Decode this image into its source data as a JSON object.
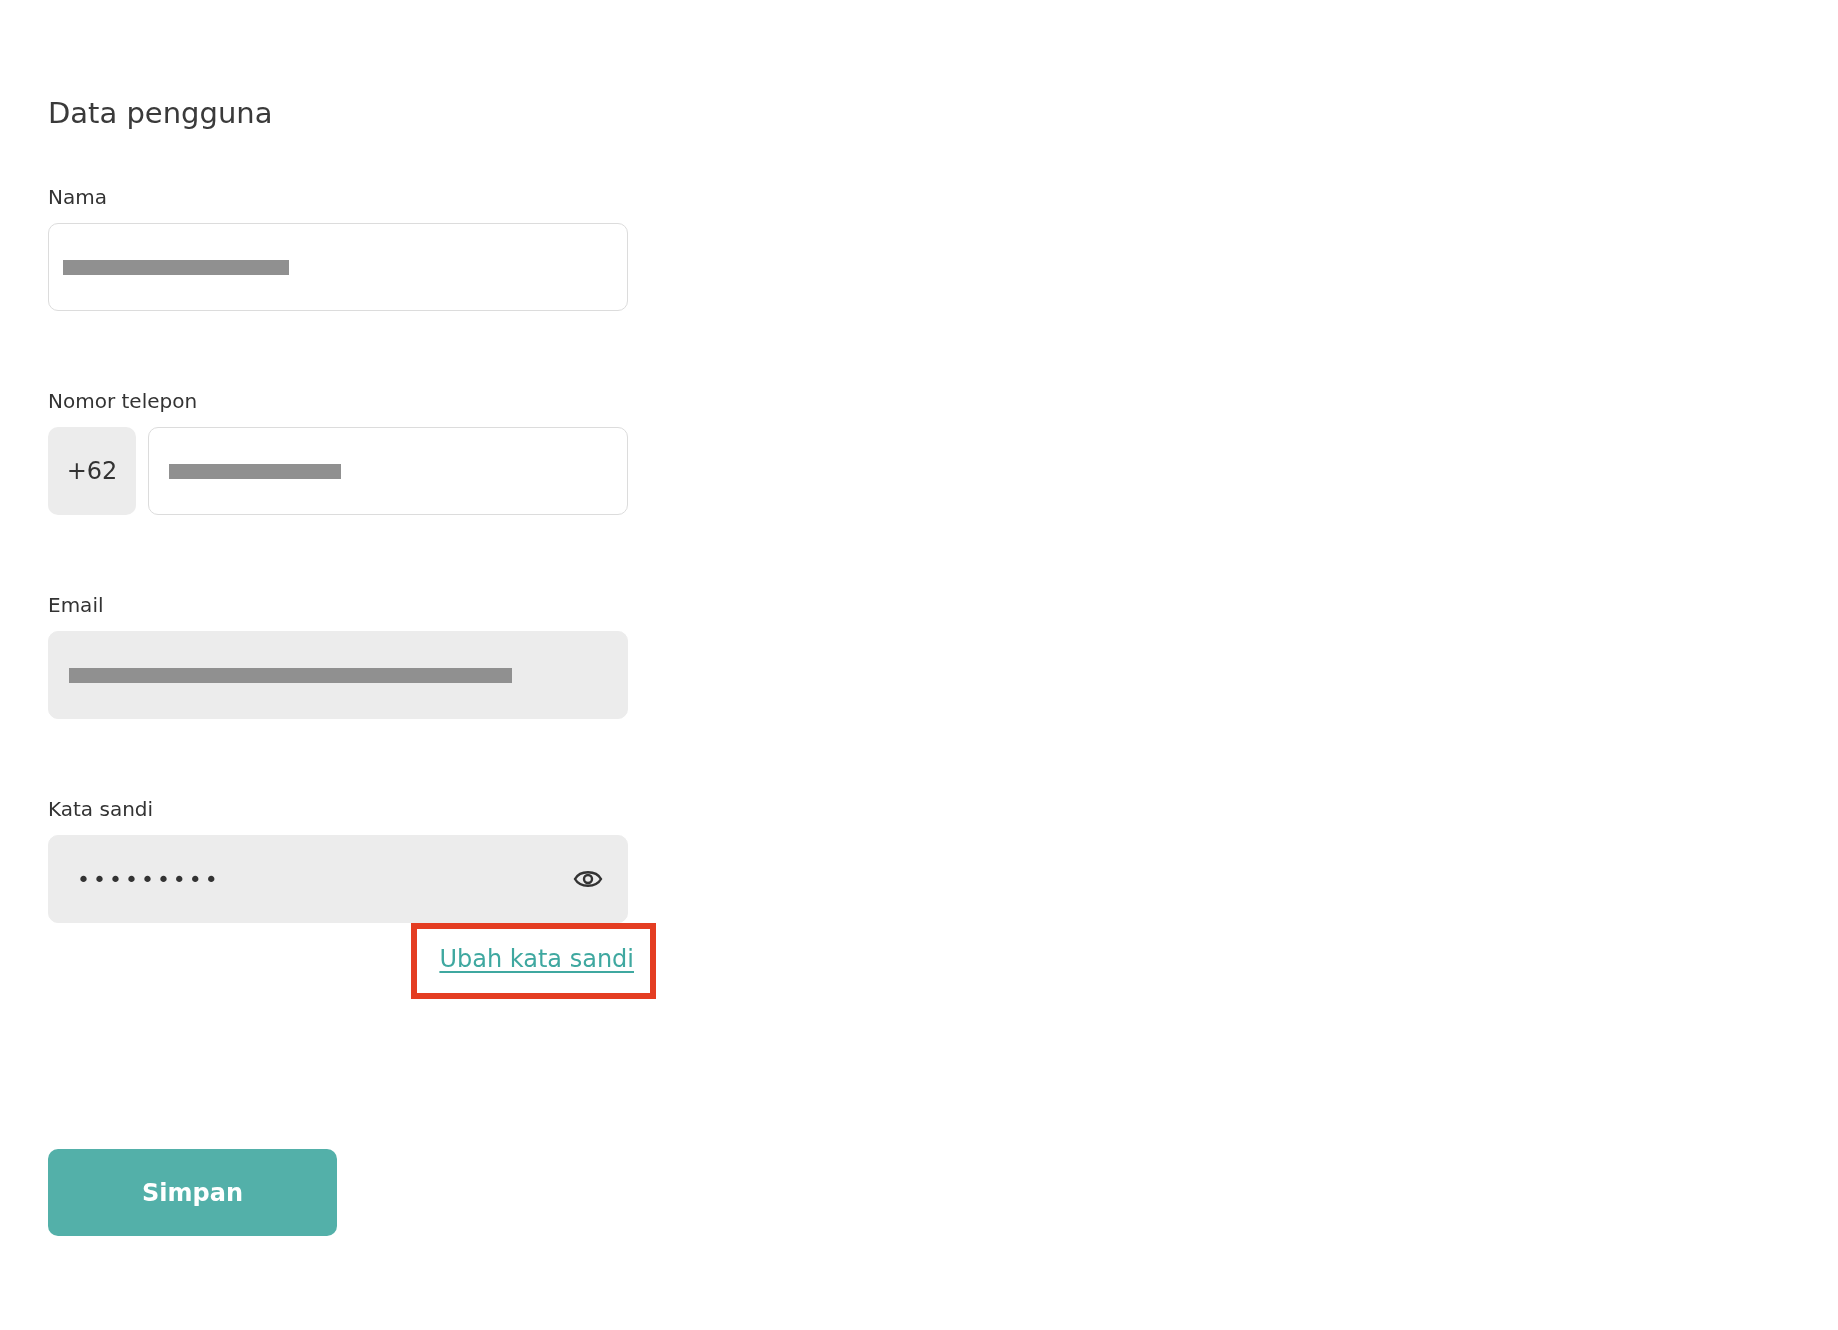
{
  "title": "Data pengguna",
  "fields": [
    {
      "kind": "name",
      "label": "Nama",
      "redacted": true,
      "disabled": false
    },
    {
      "kind": "phone",
      "label": "Nomor telepon",
      "prefix": "+62",
      "redacted": true,
      "disabled": false
    },
    {
      "kind": "email",
      "label": "Email",
      "redacted": true,
      "disabled": true
    },
    {
      "kind": "password",
      "label": "Kata sandi",
      "value": "•••••••••",
      "disabled": true
    }
  ],
  "change_password_link": {
    "label": "Ubah kata sandi",
    "highlighted": true
  },
  "save_button": {
    "label": "Simpan"
  }
}
